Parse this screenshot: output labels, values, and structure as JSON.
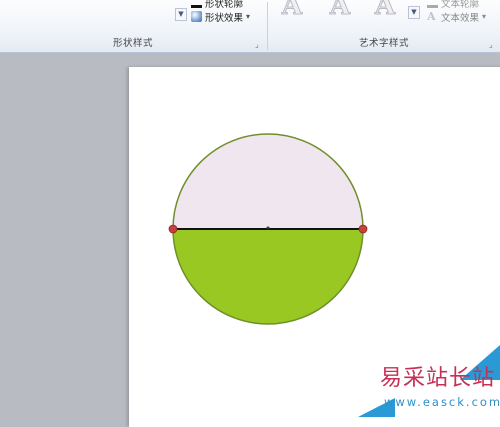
{
  "ribbon": {
    "shape_styles": {
      "outline_label": "形状轮廓",
      "effects_label": "形状效果",
      "group_label": "形状样式"
    },
    "wordart_styles": {
      "glyph": "A",
      "text_outline_label": "文本轮廓",
      "text_effects_label": "文本效果",
      "group_label": "艺术字样式"
    },
    "launcher_glyph": "⌟",
    "scroll_down": "▼",
    "dropdown": "▾"
  },
  "shape": {
    "top_fill": "#efe6ef",
    "bottom_fill": "#99c823",
    "outline": "#6f8f2a",
    "line": "#111111",
    "handle": "#c7403a"
  },
  "watermark": {
    "brand": "易采站长站",
    "url": "www.easck.com"
  }
}
